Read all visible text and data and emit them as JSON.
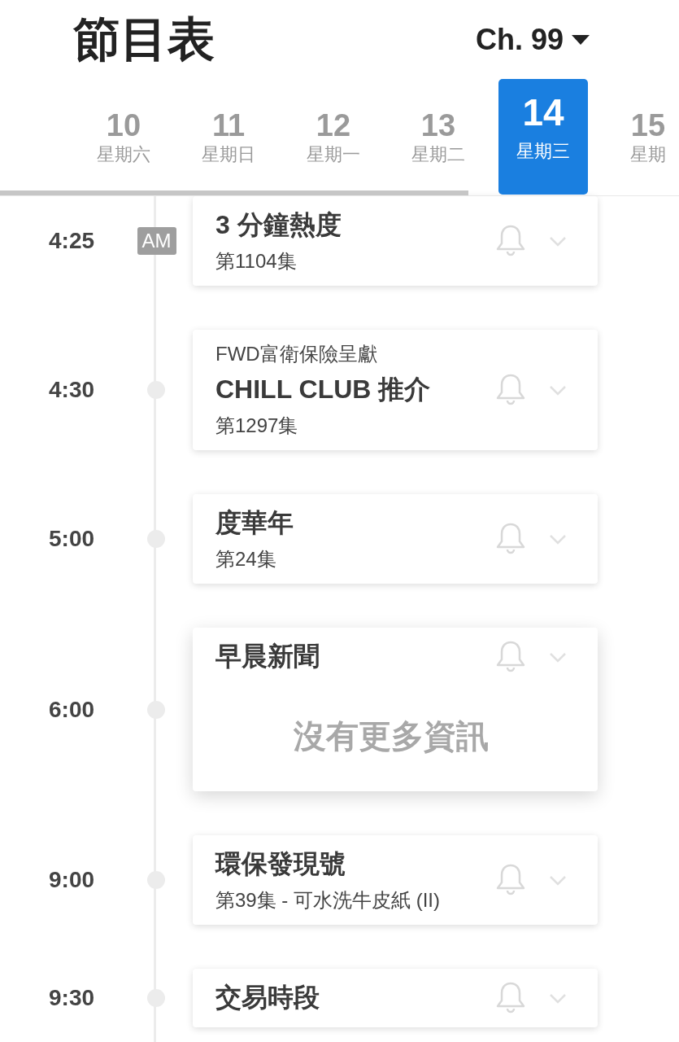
{
  "header": {
    "title": "節目表",
    "channel": "Ch. 99"
  },
  "days": [
    {
      "date": "10",
      "weekday": "星期六",
      "selected": false
    },
    {
      "date": "11",
      "weekday": "星期日",
      "selected": false
    },
    {
      "date": "12",
      "weekday": "星期一",
      "selected": false
    },
    {
      "date": "13",
      "weekday": "星期二",
      "selected": false
    },
    {
      "date": "14",
      "weekday": "星期三",
      "selected": true
    },
    {
      "date": "15",
      "weekday": "星期",
      "selected": false
    }
  ],
  "programs": [
    {
      "time": "4:25",
      "period": "AM",
      "title": "3 分鐘熱度",
      "episode": "第1104集"
    },
    {
      "time": "4:30",
      "sponsor": "FWD富衛保險呈獻",
      "title": "CHILL CLUB 推介",
      "episode": "第1297集"
    },
    {
      "time": "5:00",
      "title": "度華年",
      "episode": "第24集"
    },
    {
      "time": "6:00",
      "title": "早晨新聞",
      "detail": "沒有更多資訊"
    },
    {
      "time": "9:00",
      "title": "環保發現號",
      "episode": "第39集 - 可水洗牛皮紙 (II)"
    },
    {
      "time": "9:30",
      "title": "交易時段"
    }
  ]
}
